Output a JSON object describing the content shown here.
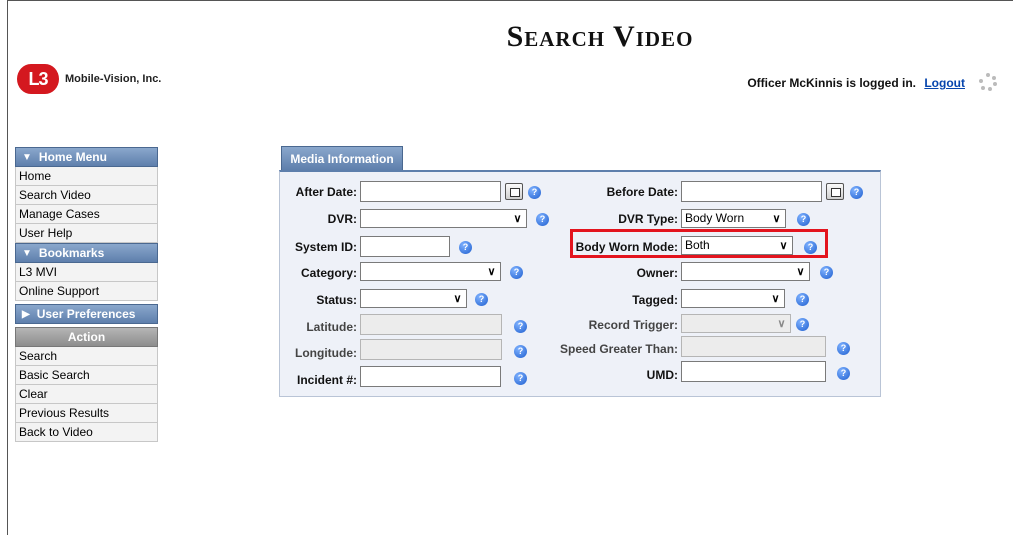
{
  "header": {
    "title": "Search Video",
    "logo_badge": "L3",
    "logo_text": "Mobile-Vision, Inc.",
    "login_status": "Officer McKinnis is logged in.",
    "logout_label": "Logout"
  },
  "sidebar": {
    "home_menu_label": "Home Menu",
    "home_items": [
      "Home",
      "Search Video",
      "Manage Cases",
      "User Help"
    ],
    "bookmarks_label": "Bookmarks",
    "bookmark_items": [
      "L3 MVI",
      "Online Support"
    ],
    "user_prefs_label": "User Preferences",
    "action_label": "Action",
    "action_items": [
      "Search",
      "Basic Search",
      "Clear",
      "Previous Results",
      "Back to Video"
    ]
  },
  "tab": {
    "label": "Media Information"
  },
  "form": {
    "after_date": {
      "label": "After Date:",
      "value": ""
    },
    "before_date": {
      "label": "Before Date:",
      "value": ""
    },
    "dvr": {
      "label": "DVR:",
      "value": ""
    },
    "dvr_type": {
      "label": "DVR Type:",
      "value": "Body Worn"
    },
    "system_id": {
      "label": "System ID:",
      "value": ""
    },
    "body_worn_mode": {
      "label": "Body Worn Mode:",
      "value": "Both"
    },
    "category": {
      "label": "Category:",
      "value": ""
    },
    "owner": {
      "label": "Owner:",
      "value": ""
    },
    "status": {
      "label": "Status:",
      "value": ""
    },
    "tagged": {
      "label": "Tagged:",
      "value": ""
    },
    "latitude": {
      "label": "Latitude:",
      "value": ""
    },
    "record_trigger": {
      "label": "Record Trigger:",
      "value": ""
    },
    "longitude": {
      "label": "Longitude:",
      "value": ""
    },
    "speed": {
      "label": "Speed Greater Than:",
      "value": ""
    },
    "incident": {
      "label": "Incident #:",
      "value": ""
    },
    "umd": {
      "label": "UMD:",
      "value": ""
    }
  },
  "icons": {
    "help": "help-icon",
    "calendar": "calendar-icon",
    "dropdown": "chevron-down-icon"
  },
  "colors": {
    "menu_header": "#5e7fac",
    "action_header": "#8d8d8d",
    "panel_bg": "#eef1f8",
    "highlight": "#e3141e",
    "logo": "#d4181f"
  }
}
